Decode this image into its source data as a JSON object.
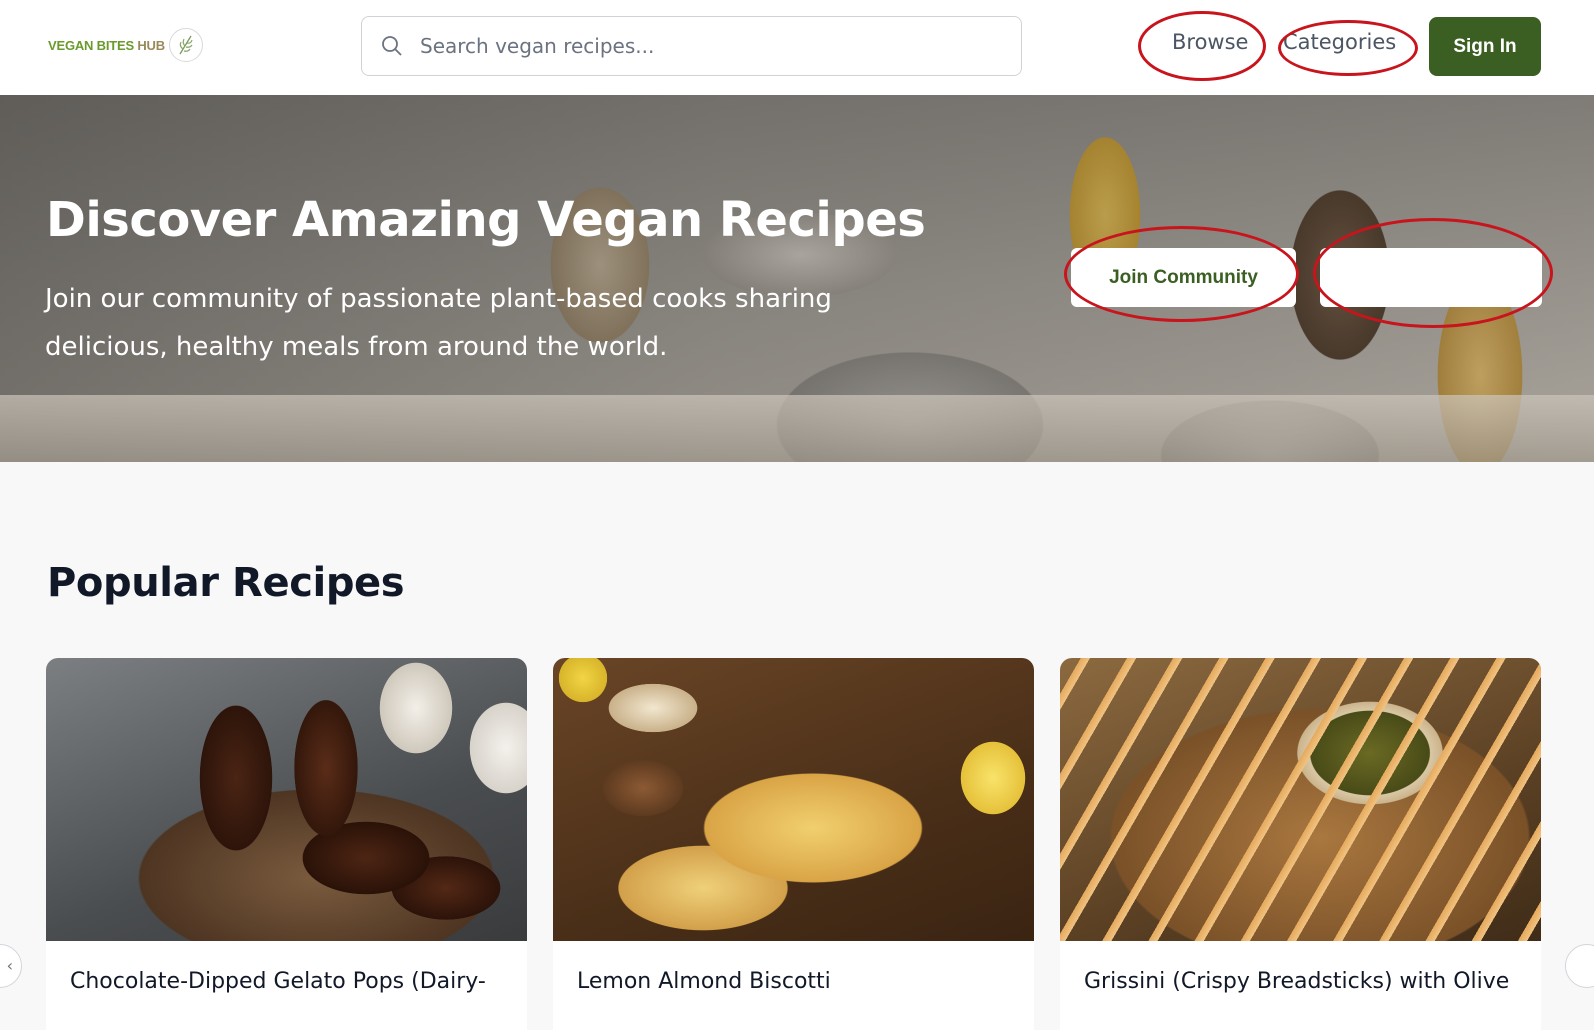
{
  "header": {
    "logo": {
      "text_part1": "VEGAN BITES ",
      "text_part2": "HUB"
    },
    "search": {
      "placeholder": "Search vegan recipes...",
      "value": ""
    },
    "nav": {
      "browse": "Browse",
      "categories": "Categories"
    },
    "sign_in": "Sign In"
  },
  "hero": {
    "title": "Discover Amazing Vegan Recipes",
    "subtitle": "Join our community of passionate plant-based cooks sharing delicious, healthy meals from around the world.",
    "join_button": "Join Community",
    "second_button": ""
  },
  "popular": {
    "title": "Popular Recipes",
    "cards": [
      {
        "title": "Chocolate-Dipped Gelato Pops (Dairy-"
      },
      {
        "title": "Lemon Almond Biscotti"
      },
      {
        "title": "Grissini (Crispy Breadsticks) with Olive"
      }
    ],
    "prev_arrow": "‹"
  },
  "colors": {
    "brand_green": "#3b5e23",
    "annotation_red": "#c8141c"
  }
}
